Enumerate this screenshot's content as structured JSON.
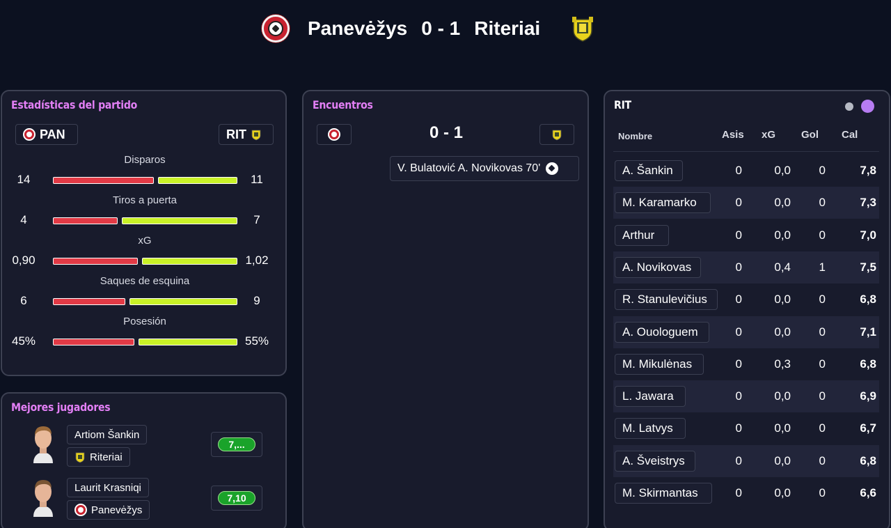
{
  "header": {
    "home_team": "Panevėžys",
    "score": "0 - 1",
    "away_team": "Riteriai"
  },
  "stats": {
    "title": "Estadísticas del partido",
    "home_abbr": "PAN",
    "away_abbr": "RIT",
    "rows": [
      {
        "label": "Disparos",
        "home": "14",
        "away": "11",
        "home_share": 0.56
      },
      {
        "label": "Tiros a puerta",
        "home": "4",
        "away": "7",
        "home_share": 0.36
      },
      {
        "label": "xG",
        "home": "0,90",
        "away": "1,02",
        "home_share": 0.47
      },
      {
        "label": "Saques de esquina",
        "home": "6",
        "away": "9",
        "home_share": 0.4
      },
      {
        "label": "Posesión",
        "home": "45%",
        "away": "55%",
        "home_share": 0.45
      }
    ]
  },
  "best_players": {
    "title": "Mejores jugadores",
    "players": [
      {
        "name": "Artiom Šankin",
        "team": "Riteriai",
        "rating": "7,..."
      },
      {
        "name": "Laurit Krasniqi",
        "team": "Panevėžys",
        "rating": "7,10"
      }
    ]
  },
  "encounters": {
    "title": "Encuentros",
    "score": "0 - 1",
    "event": "V. Bulatović A. Novikovas 70'"
  },
  "lineup": {
    "team": "RIT",
    "columns": {
      "name": "Nombre",
      "assists": "Asis",
      "xg": "xG",
      "goals": "Gol",
      "rating": "Cal"
    },
    "players": [
      {
        "name": "A. Šankin",
        "assists": "0",
        "xg": "0,0",
        "goals": "0",
        "rating": "7,8"
      },
      {
        "name": "M. Karamarko",
        "assists": "0",
        "xg": "0,0",
        "goals": "0",
        "rating": "7,3"
      },
      {
        "name": "Arthur",
        "assists": "0",
        "xg": "0,0",
        "goals": "0",
        "rating": "7,0"
      },
      {
        "name": "A. Novikovas",
        "assists": "0",
        "xg": "0,4",
        "goals": "1",
        "rating": "7,5"
      },
      {
        "name": "R. Stanulevičius",
        "assists": "0",
        "xg": "0,0",
        "goals": "0",
        "rating": "6,8"
      },
      {
        "name": "A. Ouologuem",
        "assists": "0",
        "xg": "0,0",
        "goals": "0",
        "rating": "7,1"
      },
      {
        "name": "M. Mikulėnas",
        "assists": "0",
        "xg": "0,3",
        "goals": "0",
        "rating": "6,8"
      },
      {
        "name": "L. Jawara",
        "assists": "0",
        "xg": "0,0",
        "goals": "0",
        "rating": "6,9"
      },
      {
        "name": "M. Latvys",
        "assists": "0",
        "xg": "0,0",
        "goals": "0",
        "rating": "6,7"
      },
      {
        "name": "A. Šveistrys",
        "assists": "0",
        "xg": "0,0",
        "goals": "0",
        "rating": "6,8"
      },
      {
        "name": "M. Skirmantas",
        "assists": "0",
        "xg": "0,0",
        "goals": "0",
        "rating": "6,6"
      }
    ]
  },
  "colors": {
    "home_bar": "#e23a46",
    "away_bar": "#c9f227",
    "title_accent": "#e27ff5",
    "rating_good": "#1aa32a"
  }
}
